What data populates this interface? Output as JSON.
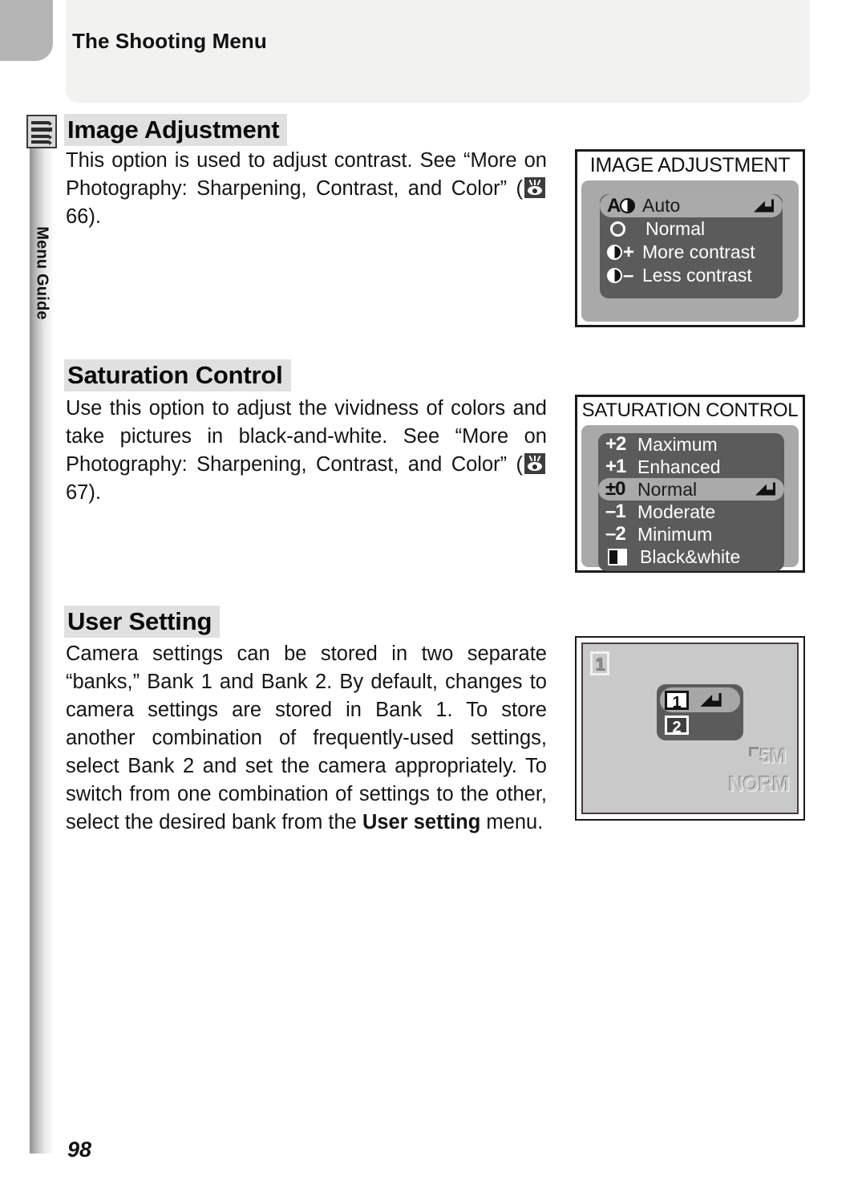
{
  "header": {
    "title": "The Shooting Menu"
  },
  "sidebar": {
    "label": "Menu Guide",
    "icon": "menu-list-icon"
  },
  "page": {
    "number": "98"
  },
  "sections": [
    {
      "heading": "Image Adjustment",
      "body_pre": "This option is used to adjust contrast.  See “More on Photography: Sharpening, Contrast, and Color” (",
      "body_post": " 66).",
      "ref_icon": "eye-reference-icon",
      "ref_page": "66"
    },
    {
      "heading": "Saturation Control",
      "body_pre": "Use this option to adjust the vividness of colors and take pictures in black-and-white.  See “More on Photography: Sharpening, Contrast, and Color” (",
      "body_post": " 67).",
      "ref_icon": "eye-reference-icon",
      "ref_page": "67"
    },
    {
      "heading": "User Setting",
      "body_1": "Camera settings can be stored in two separate “banks,” Bank 1 and Bank 2.  By default, changes to camera settings are stored in Bank 1. To store another combination of frequently-used settings, select Bank 2 and set the camera appropriately.  To switch from one combination of settings to the other, select the desired bank from the ",
      "body_bold": "User setting",
      "body_2": " menu."
    }
  ],
  "lcd_image_adjustment": {
    "title": "IMAGE ADJUSTMENT",
    "items": [
      {
        "glyph": "auto-contrast-icon",
        "glyph_text": "A",
        "label": "Auto",
        "selected": true,
        "enter_arrow": true
      },
      {
        "glyph": "open-circle-icon",
        "glyph_text": "",
        "label": "Normal",
        "selected": false,
        "enter_arrow": false
      },
      {
        "glyph": "half-circle-plus-icon",
        "glyph_text": "+",
        "label": "More contrast",
        "selected": false,
        "enter_arrow": false
      },
      {
        "glyph": "half-circle-minus-icon",
        "glyph_text": "–",
        "label": "Less contrast",
        "selected": false,
        "enter_arrow": false
      }
    ]
  },
  "lcd_saturation_control": {
    "title": "SATURATION CONTROL",
    "items": [
      {
        "glyph_text": "+2",
        "label": "Maximum",
        "selected": false,
        "enter_arrow": false
      },
      {
        "glyph_text": "+1",
        "label": "Enhanced",
        "selected": false,
        "enter_arrow": false
      },
      {
        "glyph_text": "±0",
        "label": "Normal",
        "selected": true,
        "enter_arrow": true
      },
      {
        "glyph_text": "–1",
        "label": "Moderate",
        "selected": false,
        "enter_arrow": false
      },
      {
        "glyph_text": "–2",
        "label": "Minimum",
        "selected": false,
        "enter_arrow": false
      },
      {
        "glyph_text": "",
        "glyph": "black-white-square-icon",
        "label": "Black&white",
        "selected": false,
        "enter_arrow": false
      }
    ]
  },
  "lcd_user_setting": {
    "corner_badge": "1",
    "banks": [
      {
        "number": "1",
        "selected": true,
        "enter_arrow": true
      },
      {
        "number": "2",
        "selected": false,
        "enter_arrow": false
      }
    ],
    "resolution": "5M",
    "quality": "NORM"
  },
  "colors": {
    "tab_gray": "#b4b4b4",
    "header_bg": "#f2f2f0",
    "heading_highlight": "#e0e0e0",
    "lcd_body": "#a9a9a9",
    "lcd_list": "#5b5b5b",
    "lcd_selected": "#aaaaaa",
    "us_screen": "#c9c9c9"
  }
}
